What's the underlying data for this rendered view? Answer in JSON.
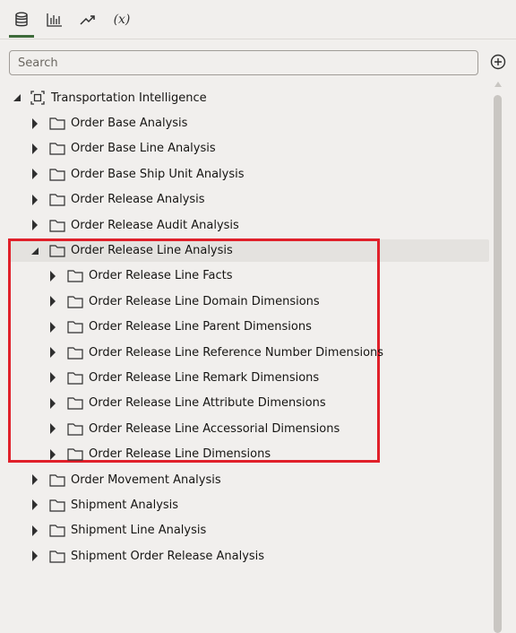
{
  "tabs": [
    {
      "name": "data-icon",
      "active": true
    },
    {
      "name": "bar-chart-icon",
      "active": false
    },
    {
      "name": "trend-icon",
      "active": false
    },
    {
      "name": "variable-icon",
      "label": "(x)",
      "active": false
    }
  ],
  "search": {
    "placeholder": "Search",
    "value": ""
  },
  "tree": {
    "root": {
      "label": "Transportation Intelligence",
      "expanded": true
    },
    "items_before": [
      {
        "label": "Order Base Analysis",
        "expanded": false
      },
      {
        "label": "Order Base Line Analysis",
        "expanded": false
      },
      {
        "label": "Order Base Ship Unit Analysis",
        "expanded": false
      },
      {
        "label": "Order Release Analysis",
        "expanded": false
      },
      {
        "label": "Order Release Audit Analysis",
        "expanded": false
      }
    ],
    "selected_item": {
      "label": "Order Release Line Analysis",
      "expanded": true
    },
    "children": [
      {
        "label": "Order Release Line Facts"
      },
      {
        "label": "Order Release Line Domain Dimensions"
      },
      {
        "label": "Order Release Line Parent Dimensions"
      },
      {
        "label": "Order Release Line Reference Number Dimensions"
      },
      {
        "label": "Order Release Line Remark Dimensions"
      },
      {
        "label": "Order Release Line Attribute Dimensions"
      },
      {
        "label": "Order Release Line Accessorial Dimensions"
      },
      {
        "label": "Order Release Line Dimensions"
      }
    ],
    "items_after": [
      {
        "label": "Order Movement Analysis",
        "expanded": false
      },
      {
        "label": "Shipment Analysis",
        "expanded": false
      },
      {
        "label": "Shipment Line Analysis",
        "expanded": false
      },
      {
        "label": "Shipment Order Release Analysis",
        "expanded": false
      }
    ]
  },
  "colors": {
    "accent": "#3e6b3a",
    "highlight": "#e0202a",
    "background": "#f1efed",
    "selected_row": "#e4e2df"
  }
}
